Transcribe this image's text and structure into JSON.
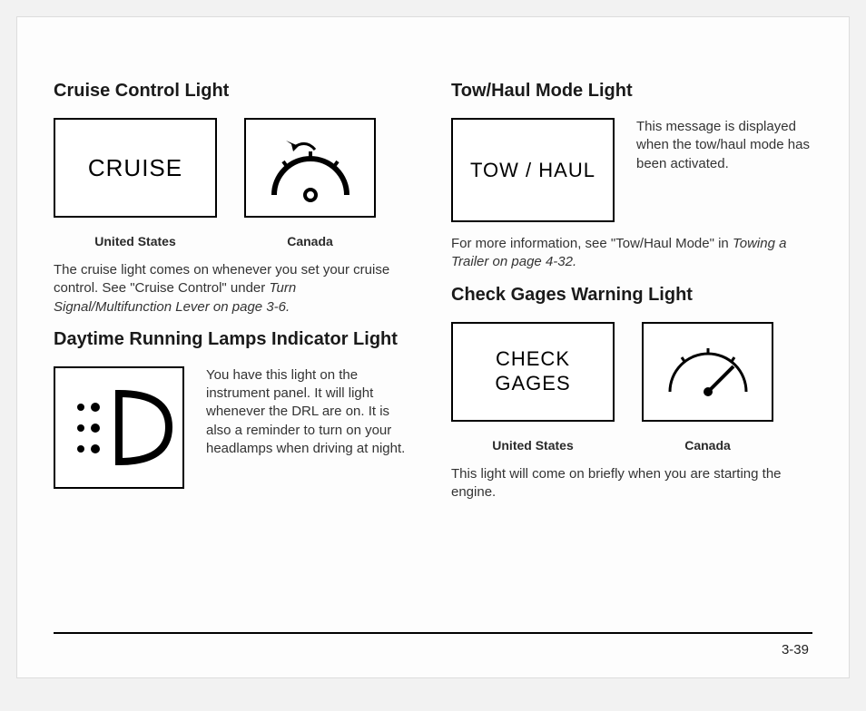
{
  "left": {
    "section1": {
      "heading": "Cruise Control Light",
      "box1_label": "CRUISE",
      "cap1": "United States",
      "cap2": "Canada",
      "para": "The cruise light comes on whenever you set your cruise control. See \"Cruise Control\" under ",
      "para_ital": "Turn Signal/Multifunction Lever on page 3-6.",
      "gauge_icon_name": "cruise-gauge-icon"
    },
    "section2": {
      "heading": "Daytime Running Lamps Indicator Light",
      "para": "You have this light on the instrument panel. It will light whenever the DRL are on. It is also a reminder to turn on your headlamps when driving at night.",
      "drl_icon_name": "drl-headlamp-icon"
    }
  },
  "right": {
    "section1": {
      "heading": "Tow/Haul Mode Light",
      "box_label": "TOW / HAUL",
      "side_para": "This message is displayed when the tow/haul mode has been activated.",
      "below": "For more information, see \"Tow/Haul Mode\" in ",
      "below_ital": "Towing a Trailer on page 4-32."
    },
    "section2": {
      "heading": "Check Gages Warning Light",
      "box_label_line1": "CHECK",
      "box_label_line2": "GAGES",
      "cap1": "United States",
      "cap2": "Canada",
      "para": "This light will come on briefly when you are starting the engine.",
      "gauge_icon_name": "check-gages-gauge-icon"
    }
  },
  "page_number": "3-39"
}
